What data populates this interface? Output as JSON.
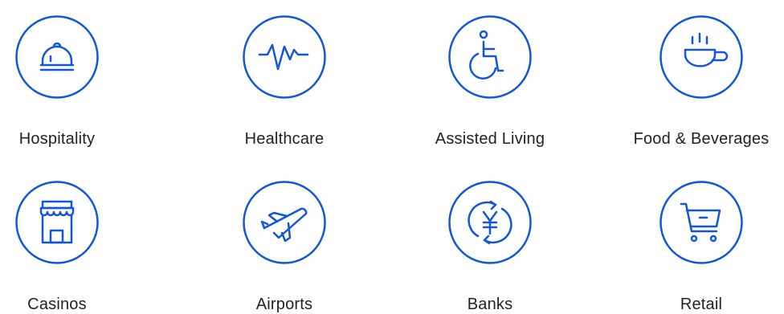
{
  "theme": {
    "accent": "#1456d8",
    "text": "#222222",
    "background": "#ffffff"
  },
  "items": [
    {
      "label": "Hospitality",
      "icon": "service-bell-icon"
    },
    {
      "label": "Healthcare",
      "icon": "heartbeat-icon"
    },
    {
      "label": "Assisted Living",
      "icon": "wheelchair-icon"
    },
    {
      "label": "Food & Beverages",
      "icon": "coffee-cup-icon"
    },
    {
      "label": "Casinos",
      "icon": "storefront-icon"
    },
    {
      "label": "Airports",
      "icon": "airplane-icon"
    },
    {
      "label": "Banks",
      "icon": "yen-exchange-icon"
    },
    {
      "label": "Retail",
      "icon": "shopping-cart-icon"
    }
  ]
}
